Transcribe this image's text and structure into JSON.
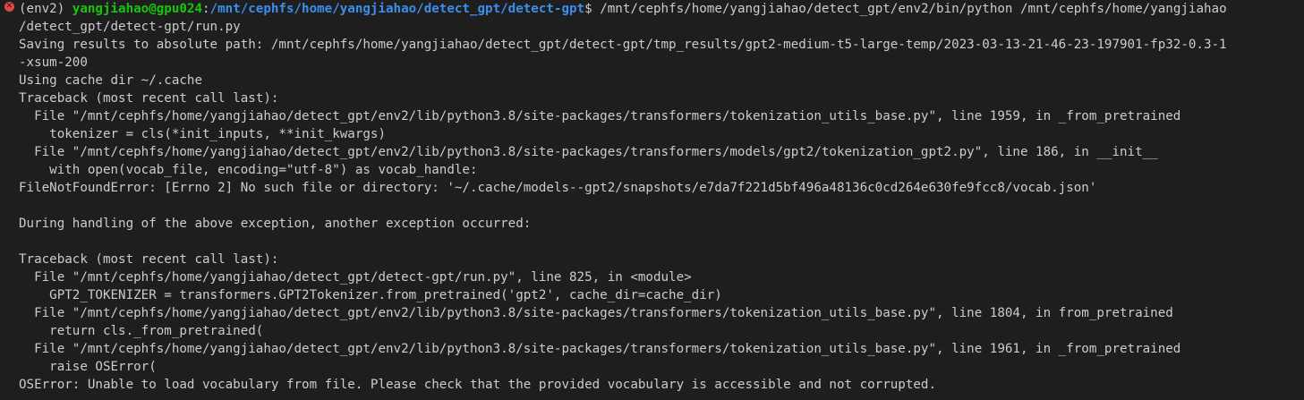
{
  "terminal": {
    "status_icon": "error-x-icon",
    "prompt": {
      "env": "(env2) ",
      "user_host": "yangjiahao@gpu024",
      "sep": ":",
      "cwd": "/mnt/cephfs/home/yangjiahao/detect_gpt/detect-gpt",
      "symbol": "$",
      "command": " /mnt/cephfs/home/yangjiahao/detect_gpt/env2/bin/python /mnt/cephfs/home/yangjiahao"
    },
    "lines": [
      "/detect_gpt/detect-gpt/run.py",
      "Saving results to absolute path: /mnt/cephfs/home/yangjiahao/detect_gpt/detect-gpt/tmp_results/gpt2-medium-t5-large-temp/2023-03-13-21-46-23-197901-fp32-0.3-1",
      "-xsum-200",
      "Using cache dir ~/.cache",
      "Traceback (most recent call last):",
      "  File \"/mnt/cephfs/home/yangjiahao/detect_gpt/env2/lib/python3.8/site-packages/transformers/tokenization_utils_base.py\", line 1959, in _from_pretrained",
      "    tokenizer = cls(*init_inputs, **init_kwargs)",
      "  File \"/mnt/cephfs/home/yangjiahao/detect_gpt/env2/lib/python3.8/site-packages/transformers/models/gpt2/tokenization_gpt2.py\", line 186, in __init__",
      "    with open(vocab_file, encoding=\"utf-8\") as vocab_handle:",
      "FileNotFoundError: [Errno 2] No such file or directory: '~/.cache/models--gpt2/snapshots/e7da7f221d5bf496a48136c0cd264e630fe9fcc8/vocab.json'",
      "",
      "During handling of the above exception, another exception occurred:",
      "",
      "Traceback (most recent call last):",
      "  File \"/mnt/cephfs/home/yangjiahao/detect_gpt/detect-gpt/run.py\", line 825, in <module>",
      "    GPT2_TOKENIZER = transformers.GPT2Tokenizer.from_pretrained('gpt2', cache_dir=cache_dir)",
      "  File \"/mnt/cephfs/home/yangjiahao/detect_gpt/env2/lib/python3.8/site-packages/transformers/tokenization_utils_base.py\", line 1804, in from_pretrained",
      "    return cls._from_pretrained(",
      "  File \"/mnt/cephfs/home/yangjiahao/detect_gpt/env2/lib/python3.8/site-packages/transformers/tokenization_utils_base.py\", line 1961, in _from_pretrained",
      "    raise OSError(",
      "OSError: Unable to load vocabulary from file. Please check that the provided vocabulary is accessible and not corrupted."
    ]
  }
}
